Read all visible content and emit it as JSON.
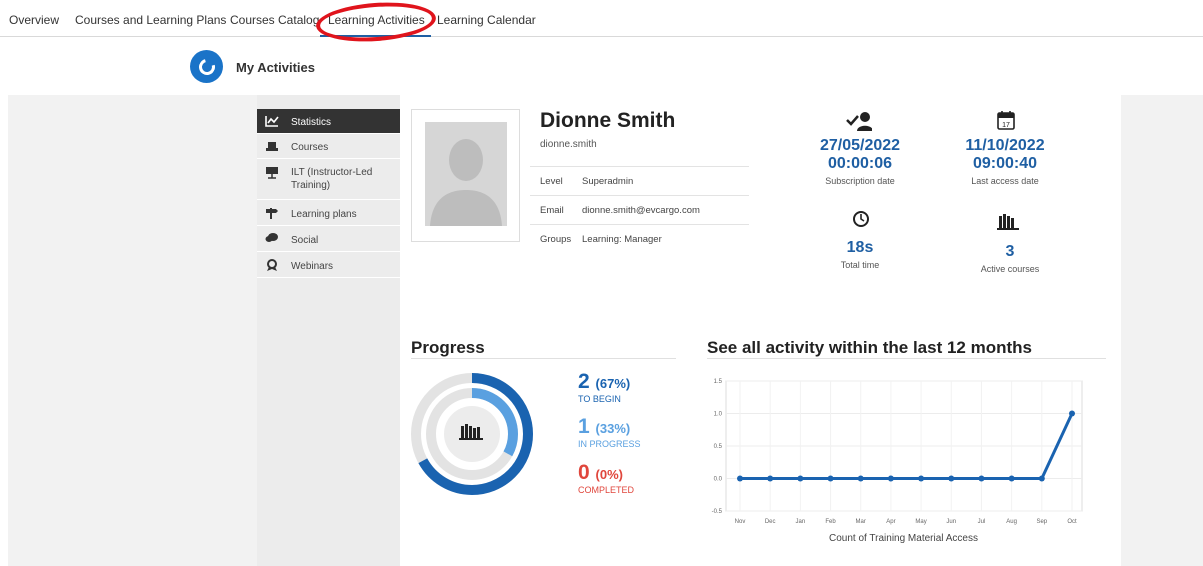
{
  "nav": {
    "tabs": [
      {
        "label": "Overview"
      },
      {
        "label": "Courses and Learning Plans"
      },
      {
        "label": "Courses Catalog"
      },
      {
        "label": "Learning Activities"
      },
      {
        "label": "Learning Calendar"
      }
    ],
    "active_tab": "Learning Activities"
  },
  "header": {
    "title": "My Activities"
  },
  "sidebar": {
    "items": [
      {
        "label": "Statistics",
        "icon": "chart-icon",
        "active": true
      },
      {
        "label": "Courses",
        "icon": "courses-icon"
      },
      {
        "label": "ILT (Instructor-Led Training)",
        "icon": "ilt-icon"
      },
      {
        "label": "Learning plans",
        "icon": "signpost-icon"
      },
      {
        "label": "Social",
        "icon": "chat-icon"
      },
      {
        "label": "Webinars",
        "icon": "webinar-icon"
      }
    ]
  },
  "profile": {
    "name": "Dionne Smith",
    "username": "dionne.smith",
    "level_key": "Level",
    "level_value": "Superadmin",
    "email_key": "Email",
    "email_value": "dionne.smith@evcargo.com",
    "groups_key": "Groups",
    "groups_value": "Learning: Manager"
  },
  "stats": {
    "subscription": {
      "date": "27/05/2022",
      "time": "00:00:06",
      "caption": "Subscription date"
    },
    "last_access": {
      "date": "11/10/2022",
      "time": "09:00:40",
      "caption": "Last access date"
    },
    "total_time": {
      "value": "18s",
      "caption": "Total time"
    },
    "active_courses": {
      "value": "3",
      "caption": "Active courses"
    },
    "calendar_day": "17"
  },
  "progress": {
    "title": "Progress",
    "to_begin": {
      "count": "2",
      "pct": "(67%)",
      "label": "TO BEGIN",
      "fraction": 0.67
    },
    "in_progress": {
      "count": "1",
      "pct": "(33%)",
      "label": "IN PROGRESS",
      "fraction": 0.33
    },
    "completed": {
      "count": "0",
      "pct": "(0%)",
      "label": "COMPLETED",
      "fraction": 0.0
    },
    "colors": {
      "to_begin": "#1a63b0",
      "in_progress": "#5aa0e0",
      "completed": "#e0463c"
    }
  },
  "activity": {
    "title": "See all activity within the last 12 months",
    "caption": "Count of Training Material Access"
  },
  "chart_data": {
    "type": "line",
    "categories": [
      "Nov",
      "Dec",
      "Jan",
      "Feb",
      "Mar",
      "Apr",
      "May",
      "Jun",
      "Jul",
      "Aug",
      "Sep",
      "Oct"
    ],
    "series": [
      {
        "values": [
          0,
          0,
          0,
          0,
          0,
          0,
          0,
          0,
          0,
          0,
          0,
          1
        ]
      }
    ],
    "xlabel": "Count of Training Material Access",
    "ylim": [
      -0.5,
      1.5
    ],
    "yticks": [
      "1.5",
      "1.0",
      "0.5",
      "0.0",
      "-0.5"
    ],
    "grid": true,
    "color": "#1a63b0"
  }
}
